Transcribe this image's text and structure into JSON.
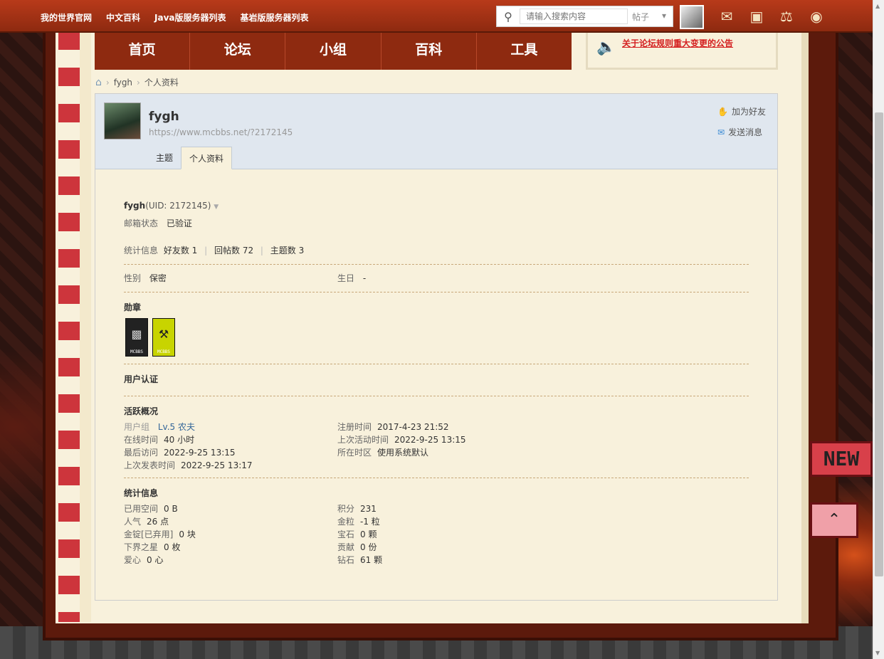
{
  "topbar": {
    "links": [
      "我的世界官网",
      "中文百科",
      "Java版服务器列表",
      "基岩版服务器列表"
    ],
    "search_placeholder": "请输入搜索内容",
    "search_type": "帖子"
  },
  "mainnav": [
    "首页",
    "论坛",
    "小组",
    "百科",
    "工具"
  ],
  "notice": "关于论坛规则重大变更的公告",
  "breadcrumb": [
    "fygh",
    "个人资料"
  ],
  "profile": {
    "name": "fygh",
    "url": "https://www.mcbbs.net/?2172145",
    "actions": {
      "add_friend": "加为好友",
      "send_message": "发送消息"
    },
    "tabs": [
      "主题",
      "个人资料"
    ],
    "uid_line": "(UID: 2172145)",
    "email_label": "邮箱状态",
    "email_value": "已验证",
    "stats_label": "统计信息",
    "stats": [
      "好友数 1",
      "回帖数 72",
      "主题数 3"
    ],
    "gender_label": "性别",
    "gender_value": "保密",
    "birthday_label": "生日",
    "birthday_value": "-",
    "medals_title": "勋章",
    "medal_text": "MCBBS",
    "verify_title": "用户认证",
    "activity_title": "活跃概况",
    "usergroup_label": "用户组",
    "usergroup_value": "Lv.5 农夫",
    "activity_left": [
      {
        "label": "在线时间",
        "value": "40 小时"
      },
      {
        "label": "最后访问",
        "value": "2022-9-25 13:15"
      },
      {
        "label": "上次发表时间",
        "value": "2022-9-25 13:17"
      }
    ],
    "activity_right": [
      {
        "label": "注册时间",
        "value": "2017-4-23 21:52"
      },
      {
        "label": "上次活动时间",
        "value": "2022-9-25 13:15"
      },
      {
        "label": "所在时区",
        "value": "使用系统默认"
      }
    ],
    "stat_title": "统计信息",
    "stat_left": [
      {
        "label": "已用空间",
        "value": "0 B"
      },
      {
        "label": "人气",
        "value": "26 点"
      },
      {
        "label": "金锭[已弃用]",
        "value": "0 块"
      },
      {
        "label": "下界之星",
        "value": "0 枚"
      },
      {
        "label": "爱心",
        "value": "0 心"
      }
    ],
    "stat_right": [
      {
        "label": "积分",
        "value": "231"
      },
      {
        "label": "金粒",
        "value": "-1 粒"
      },
      {
        "label": "宝石",
        "value": "0 颗"
      },
      {
        "label": "贡献",
        "value": "0 份"
      },
      {
        "label": "钻石",
        "value": "61 颗"
      }
    ]
  },
  "side": {
    "new_badge": "NEW"
  }
}
